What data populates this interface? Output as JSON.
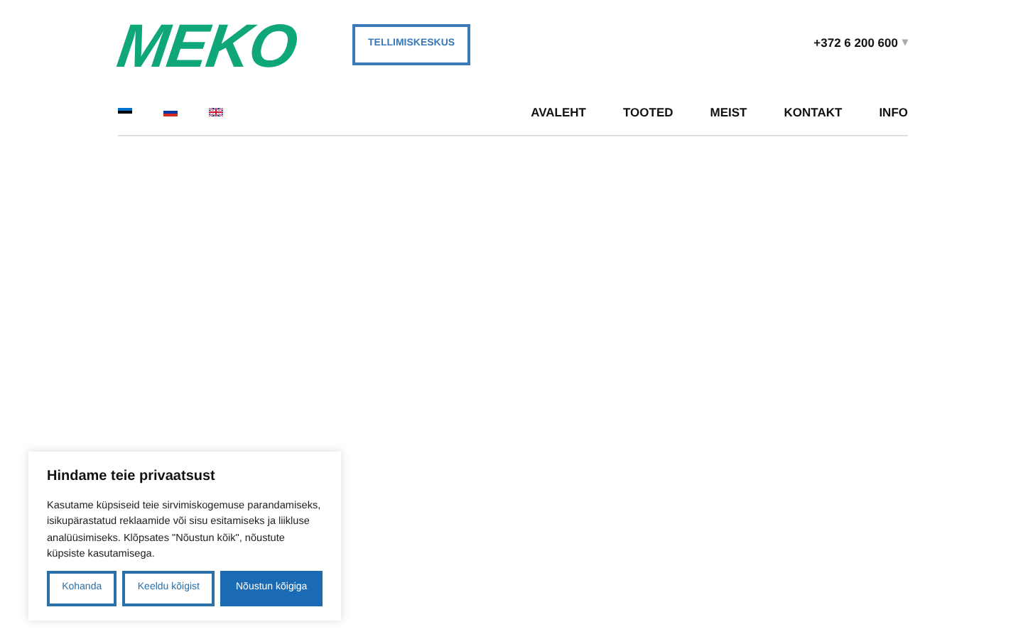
{
  "logo": "MEKO",
  "order_button": "TELLIMISKESKUS",
  "phone": {
    "number": "+372 6 200 600",
    "caret": "▾"
  },
  "languages": [
    {
      "kind": "et"
    },
    {
      "kind": "ru"
    },
    {
      "kind": "en"
    }
  ],
  "nav": [
    "AVALEHT",
    "TOOTED",
    "MEIST",
    "KONTAKT",
    "INFO"
  ],
  "cookie": {
    "title": "Hindame teie privaatsust",
    "text": "Kasutame küpsiseid teie sirvimiskogemuse parandamiseks, isikupärastatud reklaamide või sisu esitamiseks ja liikluse analüüsimiseks. Klõpsates \"Nõustun kõik\", nõustute küpsiste kasutamisega.",
    "buttons": [
      {
        "label": "Kohanda",
        "kind": "outline"
      },
      {
        "label": "Keeldu kõigist",
        "kind": "outline"
      },
      {
        "label": "Nõustun kõigiga",
        "kind": "primary"
      }
    ]
  }
}
